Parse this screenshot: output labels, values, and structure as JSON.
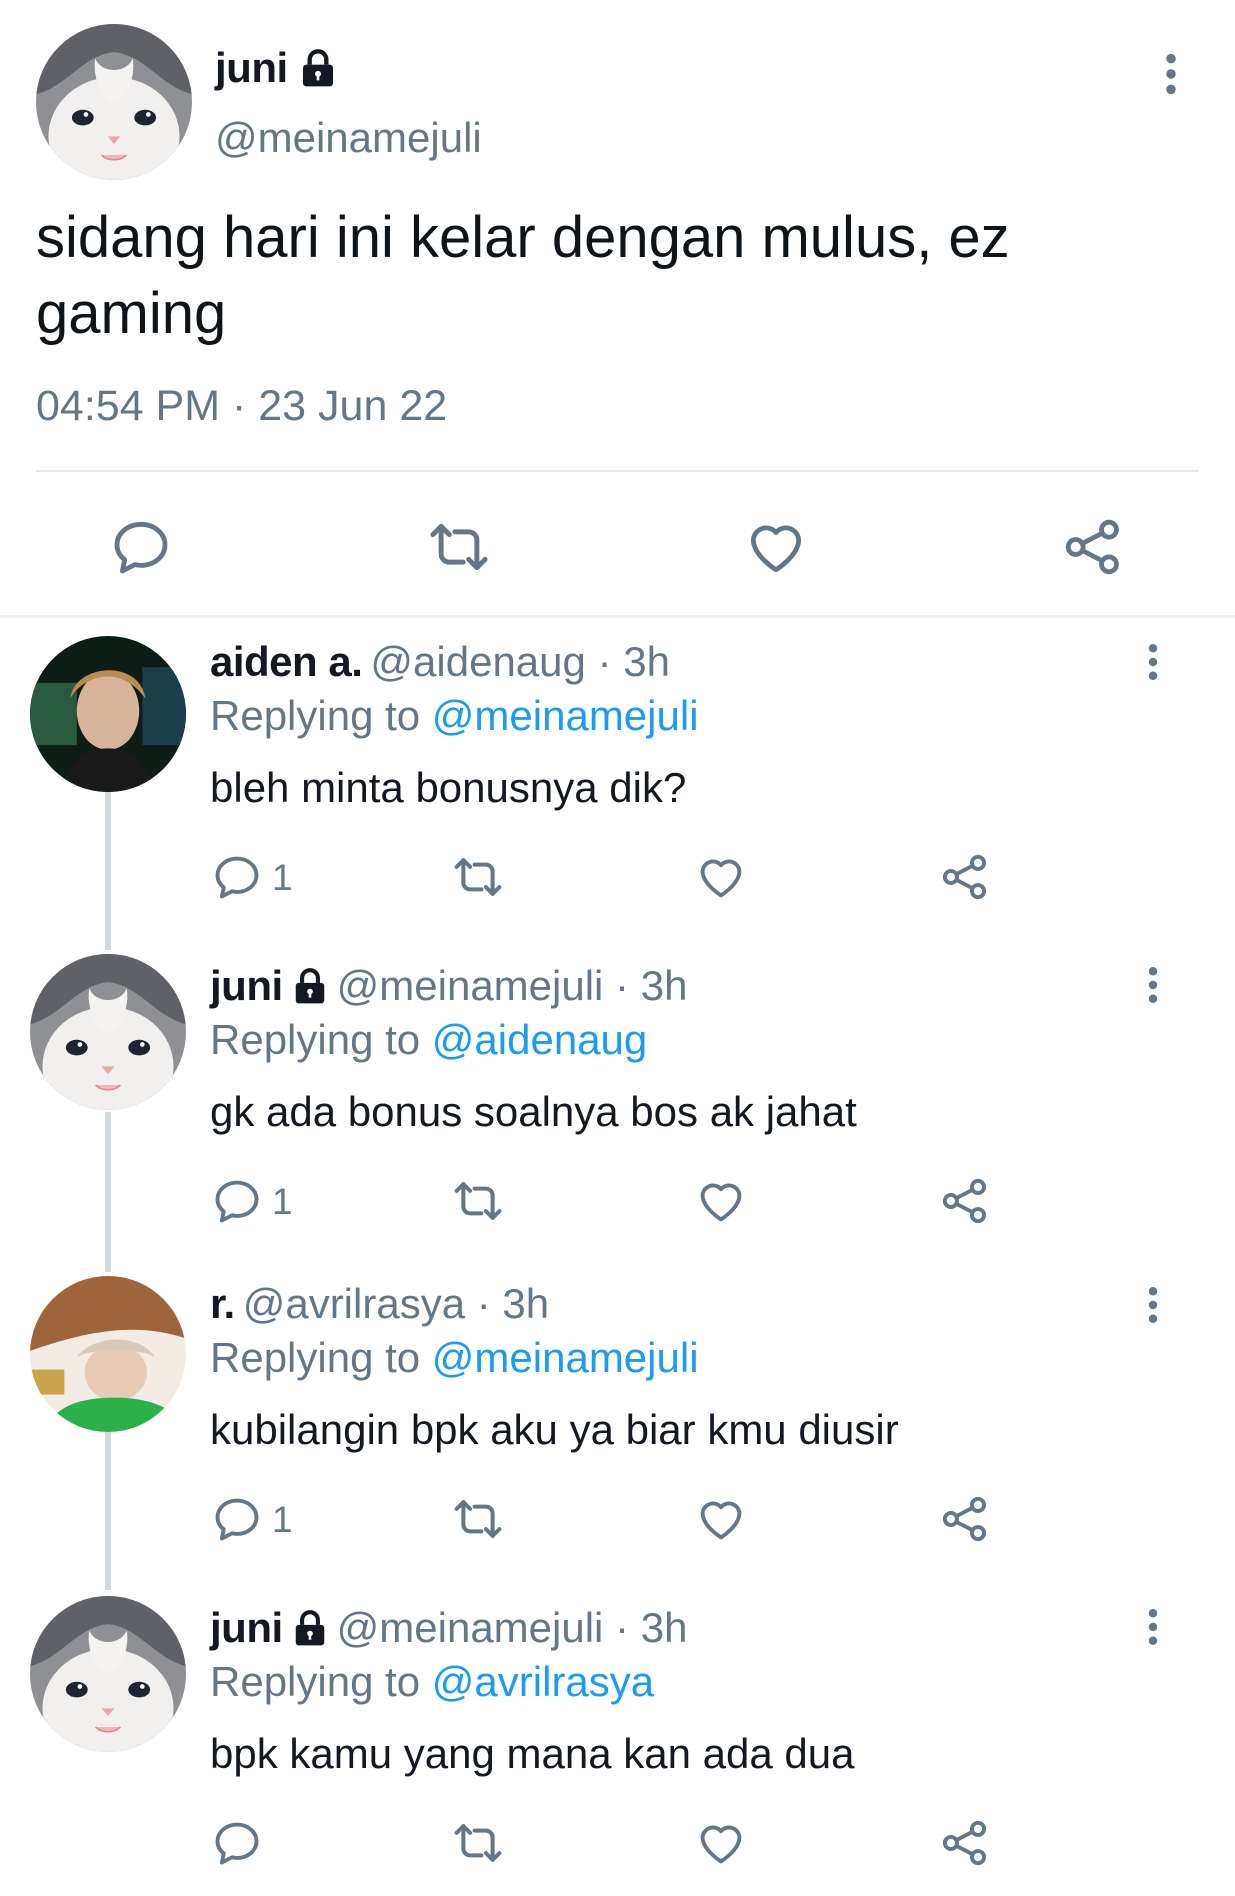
{
  "main_tweet": {
    "author_name": "juni",
    "author_handle": "@meinamejuli",
    "text": "sidang hari ini kelar dengan mulus, ez gaming",
    "timestamp": "04:54 PM · 23 Jun 22"
  },
  "icons": {
    "reply": "speech-bubble-icon",
    "retweet": "retweet-arrows-icon",
    "like": "heart-icon",
    "share": "share-nodes-icon",
    "protected": "lock-icon",
    "more": "kebab-menu-icon"
  },
  "colors": {
    "link": "#1d9bf0",
    "muted": "#657786",
    "text": "#141823"
  },
  "replies": [
    {
      "name": "aiden a.",
      "meta": "@aidenaug · 3h",
      "replying_label": "Replying to",
      "replying_to": "@meinamejuli",
      "text": "bleh minta bonusnya dik?",
      "reply_count": "1"
    },
    {
      "name": "juni",
      "meta": "@meinamejuli · 3h",
      "replying_label": "Replying to",
      "replying_to": "@aidenaug",
      "text": "gk ada bonus soalnya bos ak jahat",
      "reply_count": "1"
    },
    {
      "name": "r.",
      "meta": "@avrilrasya · 3h",
      "replying_label": "Replying to",
      "replying_to": "@meinamejuli",
      "text": "kubilangin bpk aku ya biar kmu diusir",
      "reply_count": "1"
    },
    {
      "name": "juni",
      "meta": "@meinamejuli · 3h",
      "replying_label": "Replying to",
      "replying_to": "@avrilrasya",
      "text": "bpk kamu yang mana kan ada dua",
      "reply_count": ""
    }
  ]
}
